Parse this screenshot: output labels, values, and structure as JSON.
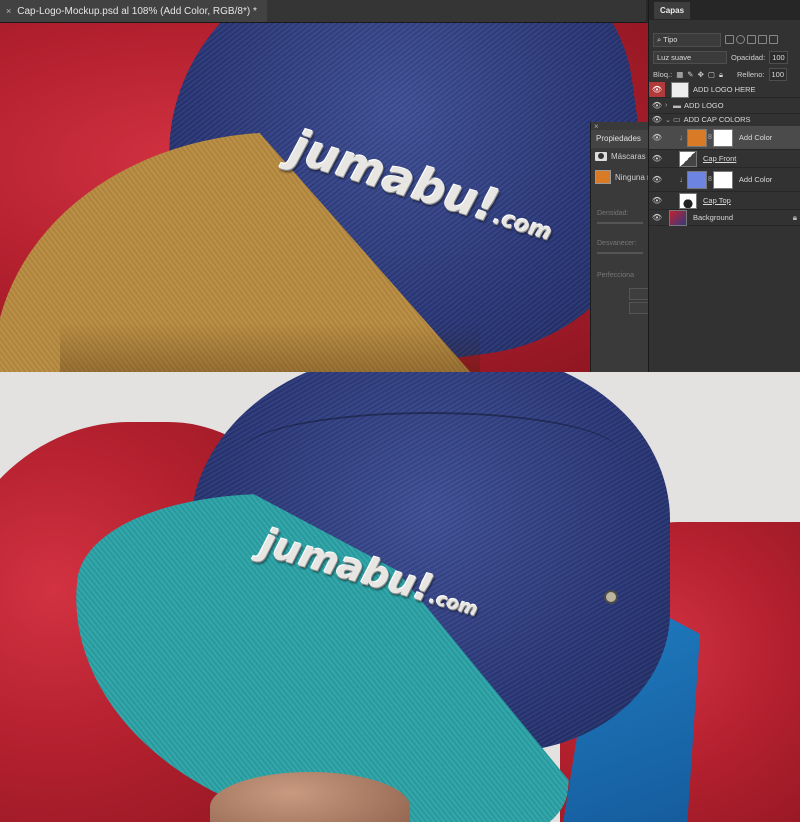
{
  "document": {
    "tab_close": "×",
    "tab_title": "Cap-Logo-Mockup.psd al 108% (Add Color, RGB/8*) *"
  },
  "logo": {
    "main": "jumabu!",
    "suffix": ".com"
  },
  "properties_panel": {
    "close": "×",
    "title": "Propiedades",
    "masks_label": "Máscaras",
    "mask_value": "Ninguna m",
    "density_label": "Densidad:",
    "feather_label": "Desvanecer:",
    "refine_label": "Perfecciona",
    "swatch_color": "#d97a26"
  },
  "layers_panel": {
    "tab": "Capas",
    "filter_kind": "Tipo",
    "blend_mode": "Luz suave",
    "opacity_label": "Opacidad:",
    "opacity_value": "100",
    "lock_label": "Bloq.:",
    "fill_label": "Relleno:",
    "fill_value": "100",
    "layers": [
      {
        "name": "ADD LOGO HERE",
        "type": "smart",
        "eye_color": "#b33a3a"
      },
      {
        "name": "ADD LOGO",
        "type": "group"
      },
      {
        "name": "ADD CAP COLORS",
        "type": "group-open"
      },
      {
        "name": "Add Color",
        "type": "fill",
        "color": "#d97a26",
        "selected": true
      },
      {
        "name": "Cap Front",
        "type": "mask",
        "underlined": true
      },
      {
        "name": "Add Color",
        "type": "fill",
        "color": "#6d85e0"
      },
      {
        "name": "Cap Top",
        "type": "mask",
        "underlined": true
      },
      {
        "name": "Background",
        "type": "image",
        "locked": true
      }
    ]
  },
  "colors": {
    "brim_top": "#b78a3e",
    "brim_bottom": "#2aa2a6",
    "crown": "#2e3b80",
    "jacket_red": "#c4202e",
    "jacket_blue": "#1a6fb0"
  }
}
